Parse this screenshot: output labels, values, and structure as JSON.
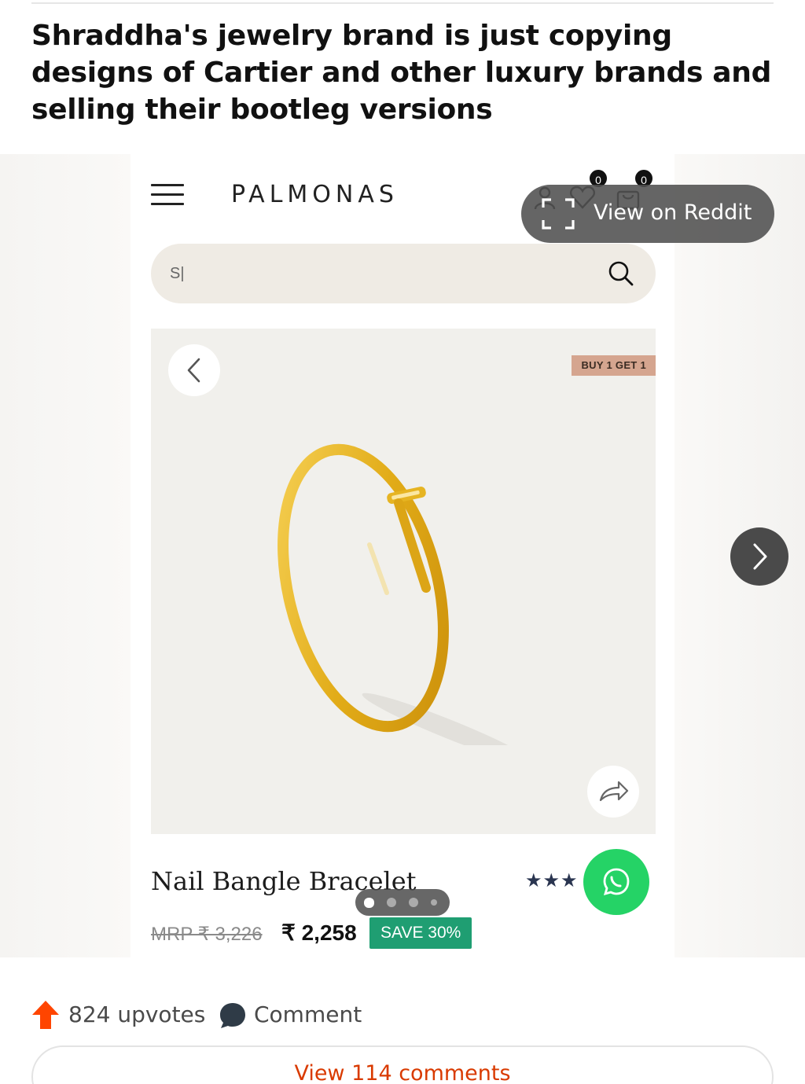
{
  "post": {
    "title": "Shraddha's jewelry brand is just copying designs of Cartier and other luxury brands and selling their bootleg versions",
    "upvotes": "824 upvotes",
    "comment_label": "Comment",
    "view_comments": "View 114 comments"
  },
  "overlay": {
    "view_on_reddit": "View on Reddit"
  },
  "screenshot": {
    "brand": "PALMONAS",
    "wishlist_count": "0",
    "cart_count": "0",
    "search_value": "S|",
    "promo_badge": "BUY 1 GET 1",
    "product_name": "Nail Bangle Bracelet",
    "rating_stars": "★★★",
    "mrp": "MRP ₹ 3,226",
    "price": "₹ 2,258",
    "save_badge": "SAVE 30%"
  },
  "gallery": {
    "total_slides": 4,
    "active_index": 0
  },
  "colors": {
    "reddit_orange": "#ff4500",
    "comment_link": "#d93a00",
    "save_green": "#1f9e72",
    "whatsapp_green": "#25d366",
    "promo_tan": "#d5a58f",
    "gold": "#e6b422"
  },
  "icons": {
    "menu": "hamburger-icon",
    "account": "user-icon",
    "wishlist": "heart-icon",
    "cart": "bag-icon",
    "search": "search-icon",
    "prev": "chevron-left-icon",
    "next": "chevron-right-icon",
    "share": "share-icon",
    "whatsapp": "whatsapp-icon",
    "expand": "expand-icon",
    "upvote": "upvote-arrow-icon",
    "comment": "comment-bubble-icon"
  }
}
